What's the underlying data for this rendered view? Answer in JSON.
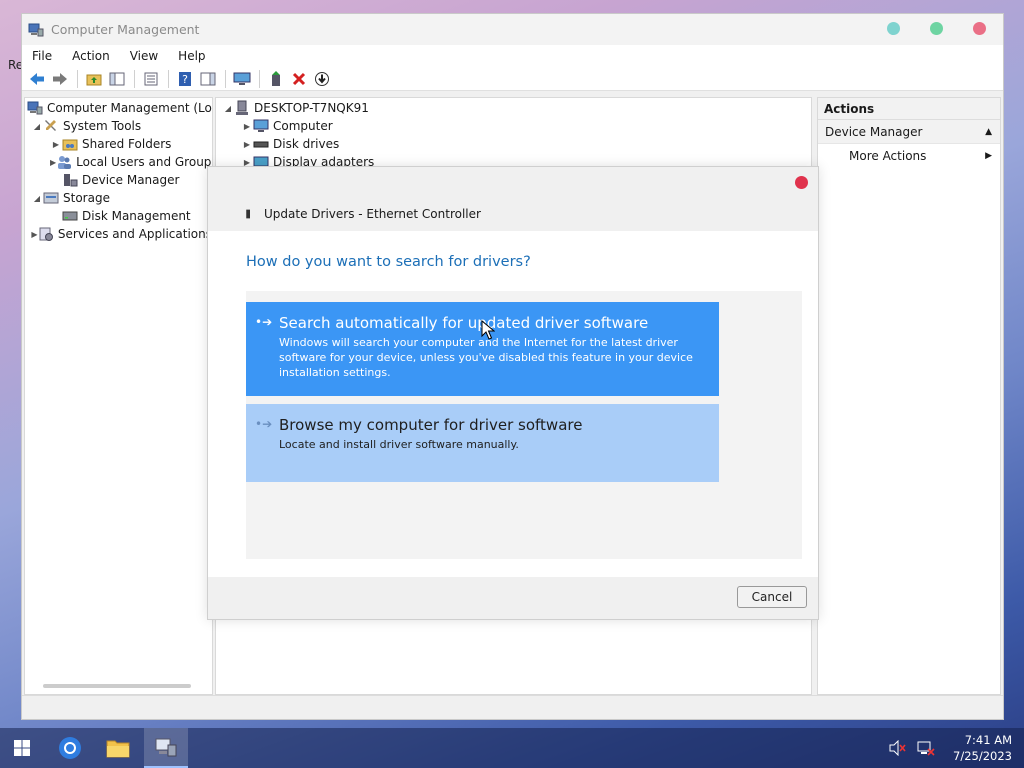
{
  "desktop": {
    "stub_text": "Re"
  },
  "window": {
    "title": "Computer Management",
    "menu": [
      "File",
      "Action",
      "View",
      "Help"
    ]
  },
  "tree": {
    "root": "Computer Management (Local",
    "system_tools": "System Tools",
    "shared_folders": "Shared Folders",
    "local_users": "Local Users and Groups",
    "device_manager": "Device Manager",
    "storage": "Storage",
    "disk_management": "Disk Management",
    "services": "Services and Applications"
  },
  "devices": {
    "host": "DESKTOP-T7NQK91",
    "items": [
      "Computer",
      "Disk drives",
      "Display adapters"
    ]
  },
  "actions": {
    "header": "Actions",
    "group": "Device Manager",
    "more": "More Actions"
  },
  "dialog": {
    "title": "Update Drivers - Ethernet Controller",
    "question": "How do you want to search for drivers?",
    "option1": {
      "title": "Search automatically for updated driver software",
      "desc": "Windows will search your computer and the Internet for the latest driver software for your device, unless you've disabled this feature in your device installation settings."
    },
    "option2": {
      "title": "Browse my computer for driver software",
      "desc": "Locate and install driver software manually."
    },
    "cancel": "Cancel"
  },
  "taskbar": {
    "time": "7:41 AM",
    "date": "7/25/2023"
  },
  "colors": {
    "accent": "#3b96f5",
    "link": "#1c6fb7",
    "close": "#e0334d"
  }
}
